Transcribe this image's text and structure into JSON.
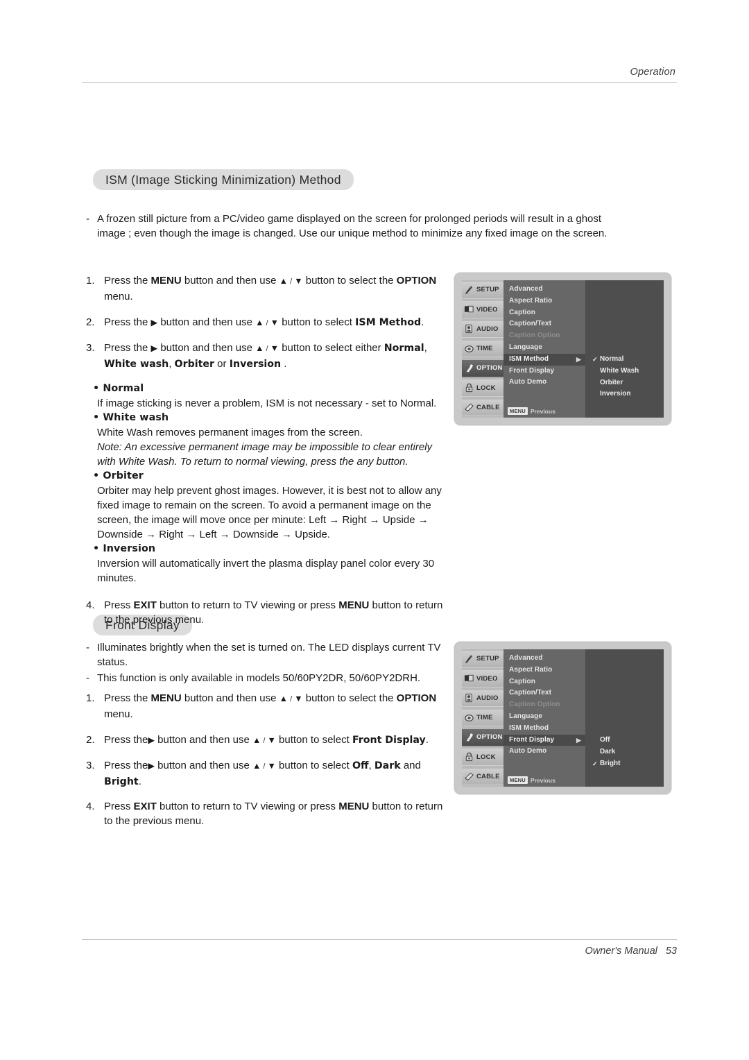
{
  "page": {
    "header_label": "Operation",
    "footer_label": "Owner's Manual",
    "footer_page": "53"
  },
  "sections": [
    {
      "title": "ISM (Image Sticking Minimization) Method",
      "intro": [
        {
          "mark": "-",
          "text": "A frozen still picture from a PC/video game displayed on the screen for prolonged periods will result in a ghost image ; even though the image is changed. Use our unique method to minimize any fixed image on the screen."
        }
      ],
      "steps": [
        {
          "num": "1.",
          "parts": [
            {
              "t": "Press the ",
              "s": "n"
            },
            {
              "t": "MENU",
              "s": "b"
            },
            {
              "t": " button and then use ",
              "s": "n"
            },
            {
              "t": "▲",
              "s": "tri"
            },
            {
              "t": " / ",
              "s": "sl"
            },
            {
              "t": "▼",
              "s": "tri"
            },
            {
              "t": "  button to select the ",
              "s": "n"
            },
            {
              "t": "OPTION",
              "s": "b"
            },
            {
              "t": " menu.",
              "s": "n"
            }
          ]
        },
        {
          "num": "2.",
          "parts": [
            {
              "t": "Press the ",
              "s": "n"
            },
            {
              "t": "▶",
              "s": "tri"
            },
            {
              "t": " button and then use ",
              "s": "n"
            },
            {
              "t": "▲",
              "s": "tri"
            },
            {
              "t": " / ",
              "s": "sl"
            },
            {
              "t": "▼",
              "s": "tri"
            },
            {
              "t": " button to select ",
              "s": "n"
            },
            {
              "t": "ISM Method",
              "s": "slab"
            },
            {
              "t": ".",
              "s": "n"
            }
          ]
        },
        {
          "num": "3.",
          "parts": [
            {
              "t": "Press the ",
              "s": "n"
            },
            {
              "t": "▶",
              "s": "tri"
            },
            {
              "t": " button and then use ",
              "s": "n"
            },
            {
              "t": "▲",
              "s": "tri"
            },
            {
              "t": " / ",
              "s": "sl"
            },
            {
              "t": "▼",
              "s": "tri"
            },
            {
              "t": " button to select either ",
              "s": "n"
            },
            {
              "t": "Normal",
              "s": "slab"
            },
            {
              "t": ", ",
              "s": "n"
            },
            {
              "t": "White wash",
              "s": "slab"
            },
            {
              "t": ", ",
              "s": "n"
            },
            {
              "t": "Orbiter",
              "s": "slab"
            },
            {
              "t": " or ",
              "s": "n"
            },
            {
              "t": "Inversion",
              "s": "slab"
            },
            {
              "t": " .",
              "s": "n"
            }
          ]
        },
        {
          "num": "4.",
          "parts": [
            {
              "t": "Press ",
              "s": "n"
            },
            {
              "t": "EXIT",
              "s": "b"
            },
            {
              "t": " button to return to TV viewing or press ",
              "s": "n"
            },
            {
              "t": "MENU",
              "s": "b"
            },
            {
              "t": " button to return to the previous menu.",
              "s": "n"
            }
          ]
        }
      ],
      "definitions": [
        {
          "bullet": "• Normal",
          "body": "If image sticking is never a problem, ISM is not necessary - set to Normal.",
          "italic": false
        },
        {
          "bullet": "• White wash",
          "body": "White Wash removes permanent images from the screen.",
          "italic": false
        },
        {
          "bullet": "",
          "body": "Note: An excessive permanent image may be impossible to clear entirely with White Wash. To return to normal viewing, press the any button.",
          "italic": true
        },
        {
          "bullet": "• Orbiter",
          "body": "Orbiter may help prevent ghost images. However, it is best not to allow any fixed image to remain on the screen. To avoid a permanent image on the screen, the image will move once per minute: Left → Right → Upside → Downside → Right → Left → Downside → Upside.",
          "italic": false
        },
        {
          "bullet": "• Inversion",
          "body": "Inversion will automatically invert the plasma display panel color every 30 minutes.",
          "italic": false
        }
      ]
    },
    {
      "title": "Front Display",
      "intro": [
        {
          "mark": "-",
          "text": "Illuminates brightly when the set is turned on. The LED displays current TV status."
        },
        {
          "mark": "-",
          "text": "This function is only available in models 50/60PY2DR, 50/60PY2DRH."
        }
      ],
      "steps": [
        {
          "num": "1.",
          "parts": [
            {
              "t": "Press the ",
              "s": "n"
            },
            {
              "t": "MENU",
              "s": "b"
            },
            {
              "t": " button and then use ",
              "s": "n"
            },
            {
              "t": "▲",
              "s": "tri"
            },
            {
              "t": " / ",
              "s": "sl"
            },
            {
              "t": "▼",
              "s": "tri"
            },
            {
              "t": "  button to select the ",
              "s": "n"
            },
            {
              "t": "OPTION",
              "s": "b"
            },
            {
              "t": " menu.",
              "s": "n"
            }
          ]
        },
        {
          "num": "2.",
          "parts": [
            {
              "t": "Press the",
              "s": "n"
            },
            {
              "t": "▶",
              "s": "tri"
            },
            {
              "t": " button and then use ",
              "s": "n"
            },
            {
              "t": "▲",
              "s": "tri"
            },
            {
              "t": " / ",
              "s": "sl"
            },
            {
              "t": "▼",
              "s": "tri"
            },
            {
              "t": " button to select ",
              "s": "n"
            },
            {
              "t": "Front Display",
              "s": "slab"
            },
            {
              "t": ".",
              "s": "n"
            }
          ]
        },
        {
          "num": "3.",
          "parts": [
            {
              "t": "Press the",
              "s": "n"
            },
            {
              "t": "▶",
              "s": "tri"
            },
            {
              "t": " button and then use ",
              "s": "n"
            },
            {
              "t": "▲",
              "s": "tri"
            },
            {
              "t": " / ",
              "s": "sl"
            },
            {
              "t": "▼",
              "s": "tri"
            },
            {
              "t": " button to select ",
              "s": "n"
            },
            {
              "t": "Off",
              "s": "slab"
            },
            {
              "t": ", ",
              "s": "n"
            },
            {
              "t": "Dark",
              "s": "slab"
            },
            {
              "t": " and ",
              "s": "n"
            },
            {
              "t": "Bright",
              "s": "slab"
            },
            {
              "t": ".",
              "s": "n"
            }
          ]
        },
        {
          "num": "4.",
          "parts": [
            {
              "t": "Press ",
              "s": "n"
            },
            {
              "t": "EXIT",
              "s": "b"
            },
            {
              "t": " button to return to TV viewing or press ",
              "s": "n"
            },
            {
              "t": "MENU",
              "s": "b"
            },
            {
              "t": " button to return to the previous menu.",
              "s": "n"
            }
          ]
        }
      ],
      "definitions": []
    }
  ],
  "osd": {
    "sidebar": [
      {
        "label": "SETUP",
        "icon": "setup-icon",
        "selected": false
      },
      {
        "label": "VIDEO",
        "icon": "video-icon",
        "selected": false
      },
      {
        "label": "AUDIO",
        "icon": "audio-icon",
        "selected": false
      },
      {
        "label": "TIME",
        "icon": "time-icon",
        "selected": false
      },
      {
        "label": "OPTION",
        "icon": "option-icon",
        "selected": true
      },
      {
        "label": "LOCK",
        "icon": "lock-icon",
        "selected": false
      },
      {
        "label": "CABLE",
        "icon": "cable-icon",
        "selected": false
      }
    ],
    "previous_badge": "MENU",
    "previous_label": "Previous",
    "menu_ism": {
      "items": [
        {
          "label": "Advanced",
          "state": "normal"
        },
        {
          "label": "Aspect Ratio",
          "state": "normal"
        },
        {
          "label": "Caption",
          "state": "normal"
        },
        {
          "label": "Caption/Text",
          "state": "normal"
        },
        {
          "label": "Caption Option",
          "state": "disabled"
        },
        {
          "label": "Language",
          "state": "normal"
        },
        {
          "label": "ISM Method",
          "state": "highlighted"
        },
        {
          "label": "Front Display",
          "state": "normal"
        },
        {
          "label": "Auto Demo",
          "state": "normal"
        }
      ],
      "options": [
        {
          "label": "Normal",
          "checked": true
        },
        {
          "label": "White Wash",
          "checked": false
        },
        {
          "label": "Orbiter",
          "checked": false
        },
        {
          "label": "Inversion",
          "checked": false
        }
      ]
    },
    "menu_front": {
      "items": [
        {
          "label": "Advanced",
          "state": "normal"
        },
        {
          "label": "Aspect Ratio",
          "state": "normal"
        },
        {
          "label": "Caption",
          "state": "normal"
        },
        {
          "label": "Caption/Text",
          "state": "normal"
        },
        {
          "label": "Caption Option",
          "state": "disabled"
        },
        {
          "label": "Language",
          "state": "normal"
        },
        {
          "label": "ISM Method",
          "state": "normal"
        },
        {
          "label": "Front Display",
          "state": "highlighted"
        },
        {
          "label": "Auto Demo",
          "state": "normal"
        }
      ],
      "options": [
        {
          "label": "Off",
          "checked": false
        },
        {
          "label": "Dark",
          "checked": false
        },
        {
          "label": "Bright",
          "checked": true
        }
      ]
    }
  },
  "colors": {
    "pill_bg": "#dcdcdc",
    "rule": "#b9b9b9",
    "osd_bezel": "#c9c9c9",
    "osd_list_bg": "#676767",
    "osd_right_bg": "#4e4e4e",
    "osd_highlight": "#4a4a4a"
  }
}
